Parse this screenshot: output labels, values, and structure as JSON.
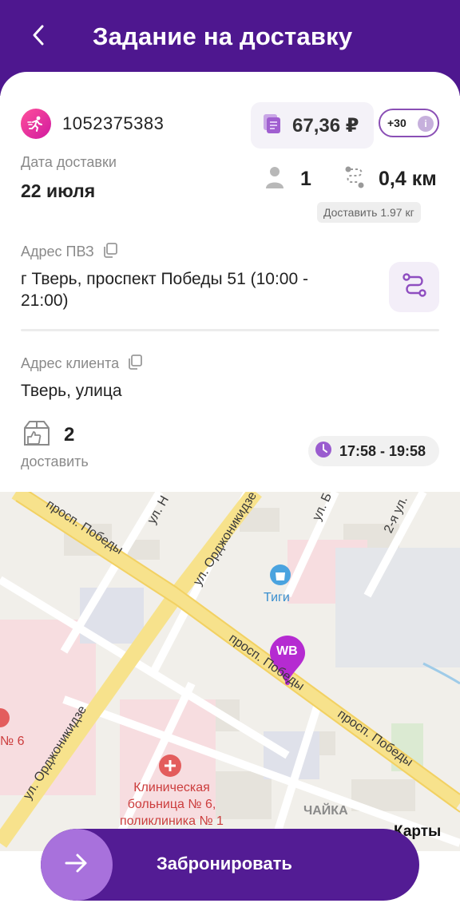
{
  "header": {
    "title": "Задание на доставку",
    "back_icon": "back-arrow-icon"
  },
  "order": {
    "number": "1052375383",
    "icon": "courier-run-icon"
  },
  "payment": {
    "price": "67,36 ₽",
    "bonus": "+30",
    "info_icon": "i",
    "price_icon": "receipt-stack-icon"
  },
  "delivery_date": {
    "label": "Дата доставки",
    "value": "22 июля"
  },
  "stats": {
    "persons": "1",
    "distance": "0,4 км",
    "weight_note": "Доставить 1.97 кг"
  },
  "pvz": {
    "label": "Адрес ПВЗ",
    "address": "г Тверь, проспект Победы 51 (10:00 - 21:00)"
  },
  "client": {
    "label": "Адрес клиента",
    "address": "Тверь, улица"
  },
  "parcels": {
    "count": "2",
    "label": "доставить"
  },
  "time_window": "17:58 - 19:58",
  "map": {
    "streets": {
      "prospekt_top": "просп. Победы",
      "ul_top": "ул. Н",
      "ordzhon_top": "ул. Орджоникидзе",
      "ul_right": "ул. Б",
      "vtoraya": "2-я ул.",
      "prospekt_mid": "просп. Победы",
      "prospekt_right": "просп. Победы",
      "ordzhon_bottom": "ул. Орджоникидзе"
    },
    "poi": {
      "shop": "Тиги",
      "hospital": "Клиническая\nбольница № 6,\nполиклиника № 1",
      "hospital_left": "№ 6",
      "chaika": "ЧАЙКА"
    },
    "marker_label": "WB",
    "attribution": "Карты"
  },
  "book_button": {
    "label": "Забронировать"
  },
  "colors": {
    "header": "#4e178f",
    "accent": "#a871dc",
    "button": "#531c94",
    "marker": "#b52bd1"
  }
}
